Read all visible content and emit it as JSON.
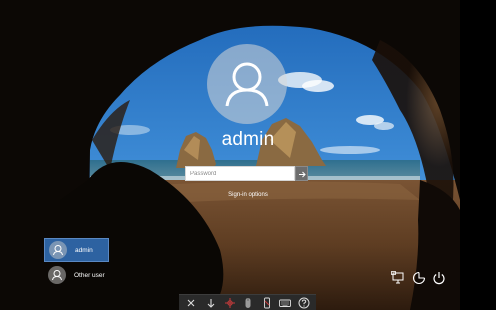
{
  "login": {
    "username": "admin",
    "password_placeholder": "Password",
    "signin_options": "Sign-in options"
  },
  "users": [
    {
      "name": "admin",
      "selected": true
    },
    {
      "name": "Other user",
      "selected": false
    }
  ],
  "system_icons": [
    "network-icon",
    "ease-of-access-icon",
    "power-icon"
  ],
  "toolbar_icons": [
    "close-icon",
    "download-icon",
    "pointer-icon",
    "mouse-icon",
    "phone-icon",
    "keyboard-icon",
    "help-icon"
  ],
  "colors": {
    "selected_user": "#2d62a1",
    "submit_button": "#6d6d6d",
    "toolbar_bg": "#2a2a2a"
  }
}
